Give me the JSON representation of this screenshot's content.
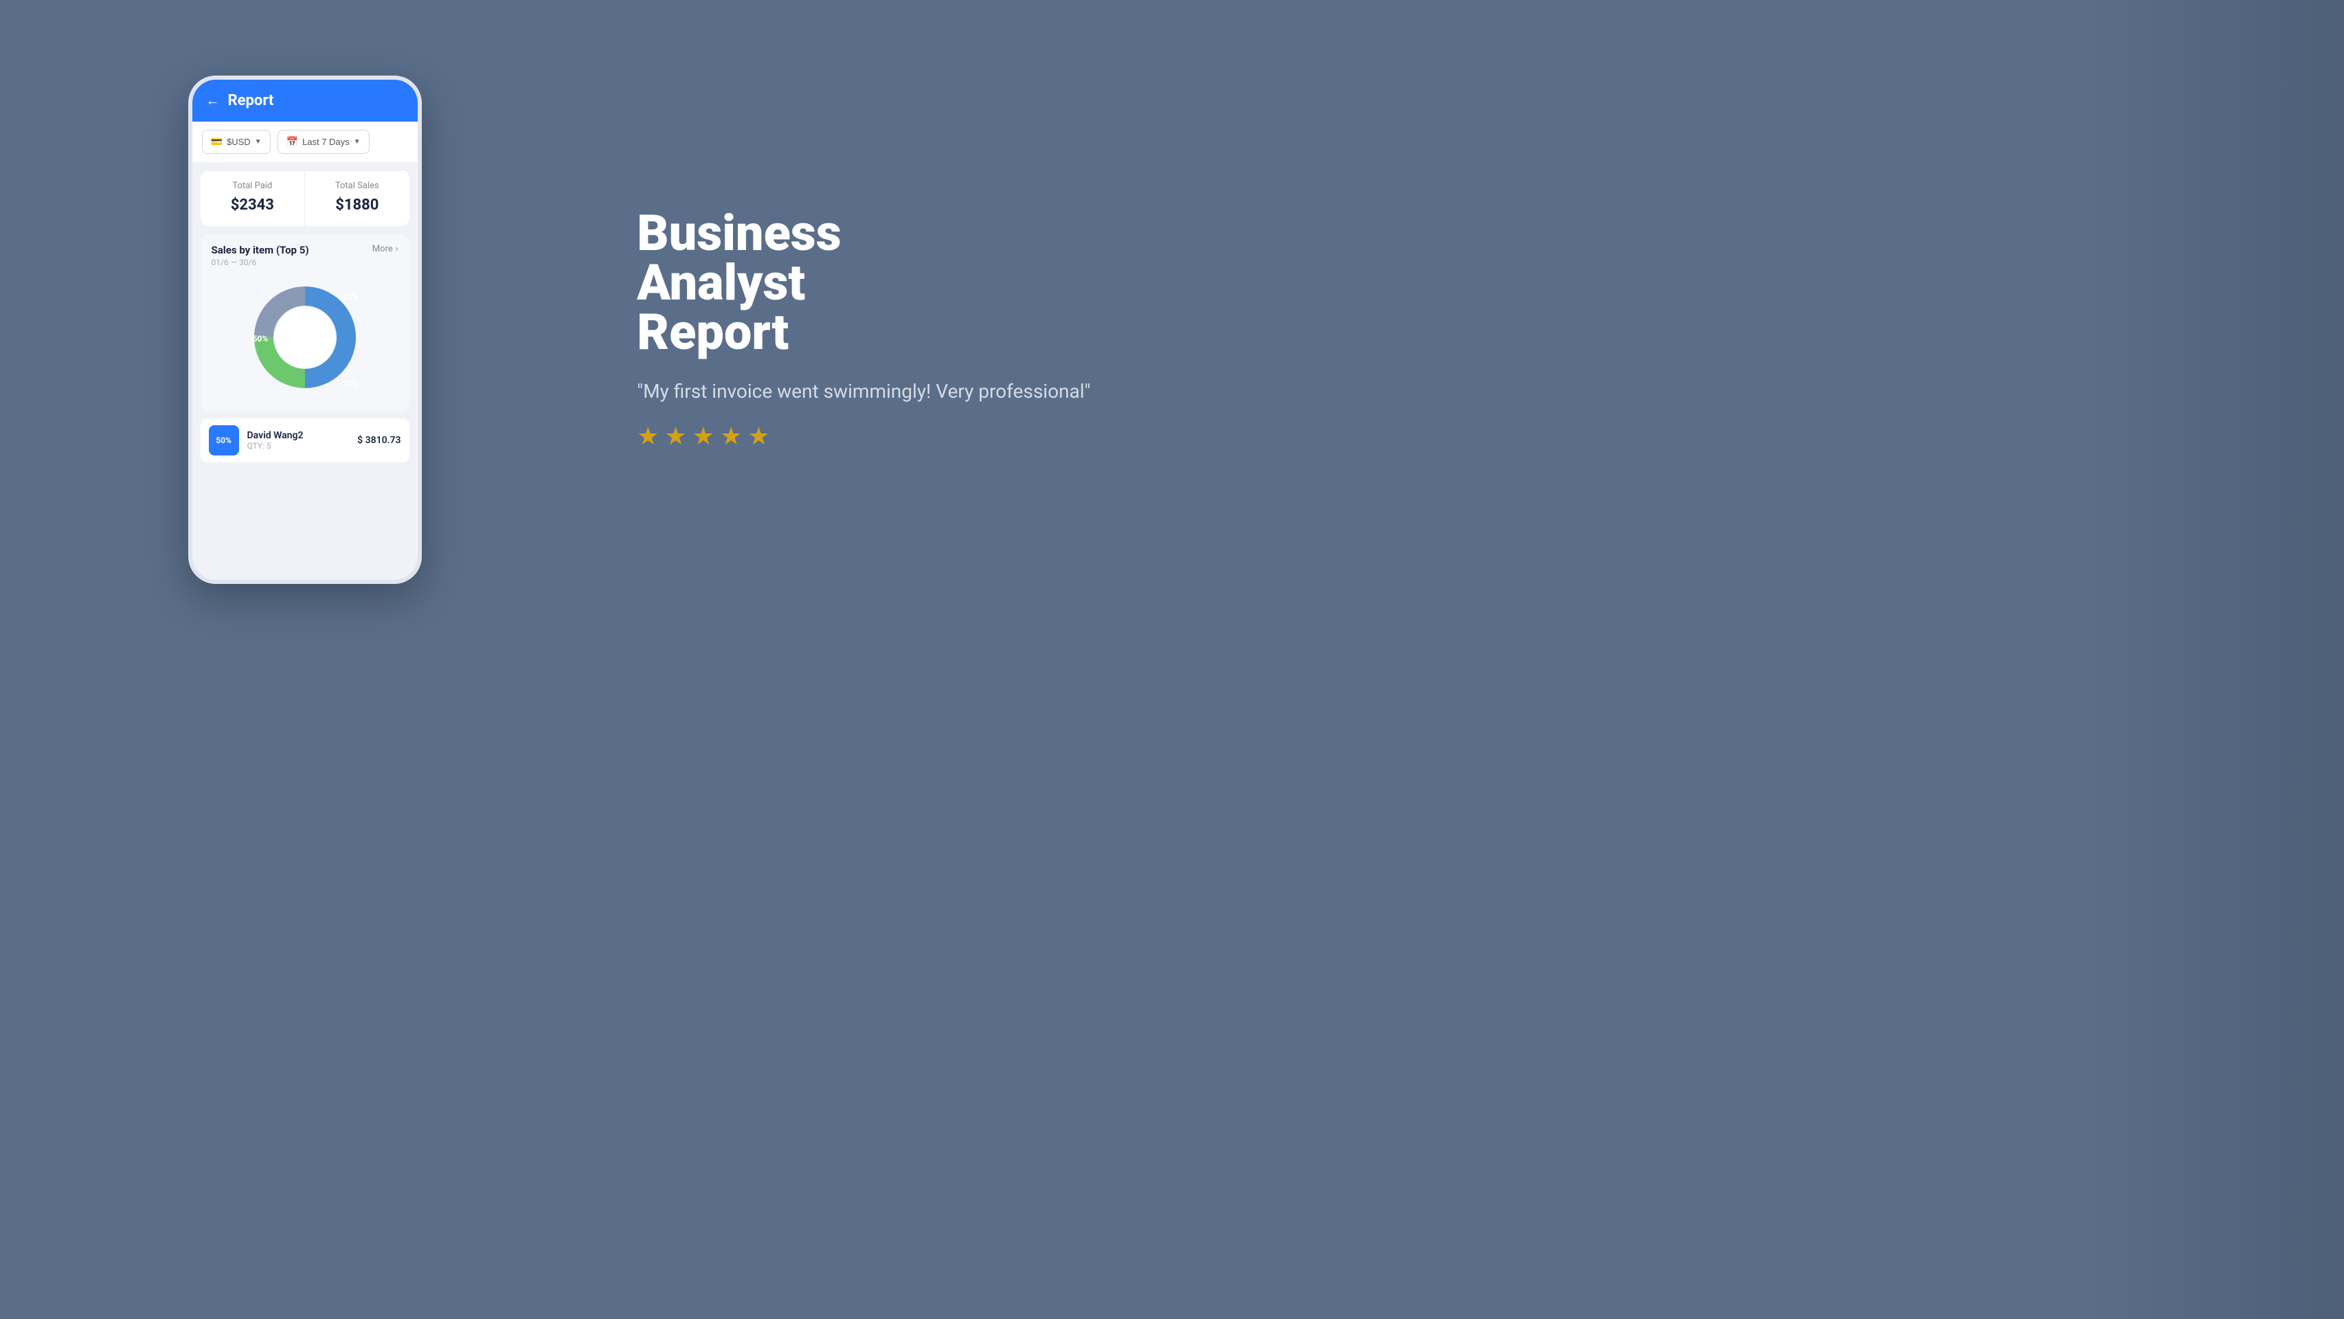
{
  "background_color": "#5a6e8a",
  "left": {
    "phone": {
      "header": {
        "back_label": "←",
        "title": "Report"
      },
      "filter": {
        "currency_icon": "💳",
        "currency_label": "$USD",
        "currency_chevron": "▼",
        "date_icon": "📅",
        "date_label": "Last 7 Days",
        "date_chevron": "▼"
      },
      "stats": {
        "total_paid_label": "Total Paid",
        "total_paid_value": "$2343",
        "total_sales_label": "Total Sales",
        "total_sales_value": "$1880"
      },
      "sales_section": {
        "title": "Sales by item (Top 5)",
        "more_label": "More",
        "more_chevron": "›",
        "date_range": "01/6 — 30/6",
        "chart": {
          "segments": [
            {
              "percent": 50,
              "color": "#4a90d9",
              "label": "50%"
            },
            {
              "percent": 25,
              "color": "#8a9ab5",
              "label": "25%"
            },
            {
              "percent": 25,
              "color": "#6dc86d",
              "label": "25%"
            }
          ]
        }
      },
      "item_row": {
        "badge": "50%",
        "name": "David Wang2",
        "qty": "QTY: 5",
        "amount": "$ 3810.73"
      }
    }
  },
  "right": {
    "headline_line1": "Business",
    "headline_line2": "Analyst",
    "headline_line3": "Report",
    "testimonial": "\"My first invoice went swimmingly! Very professional\"",
    "stars": [
      "★",
      "★",
      "★",
      "★",
      "★"
    ],
    "star_color": "#d4a017"
  }
}
